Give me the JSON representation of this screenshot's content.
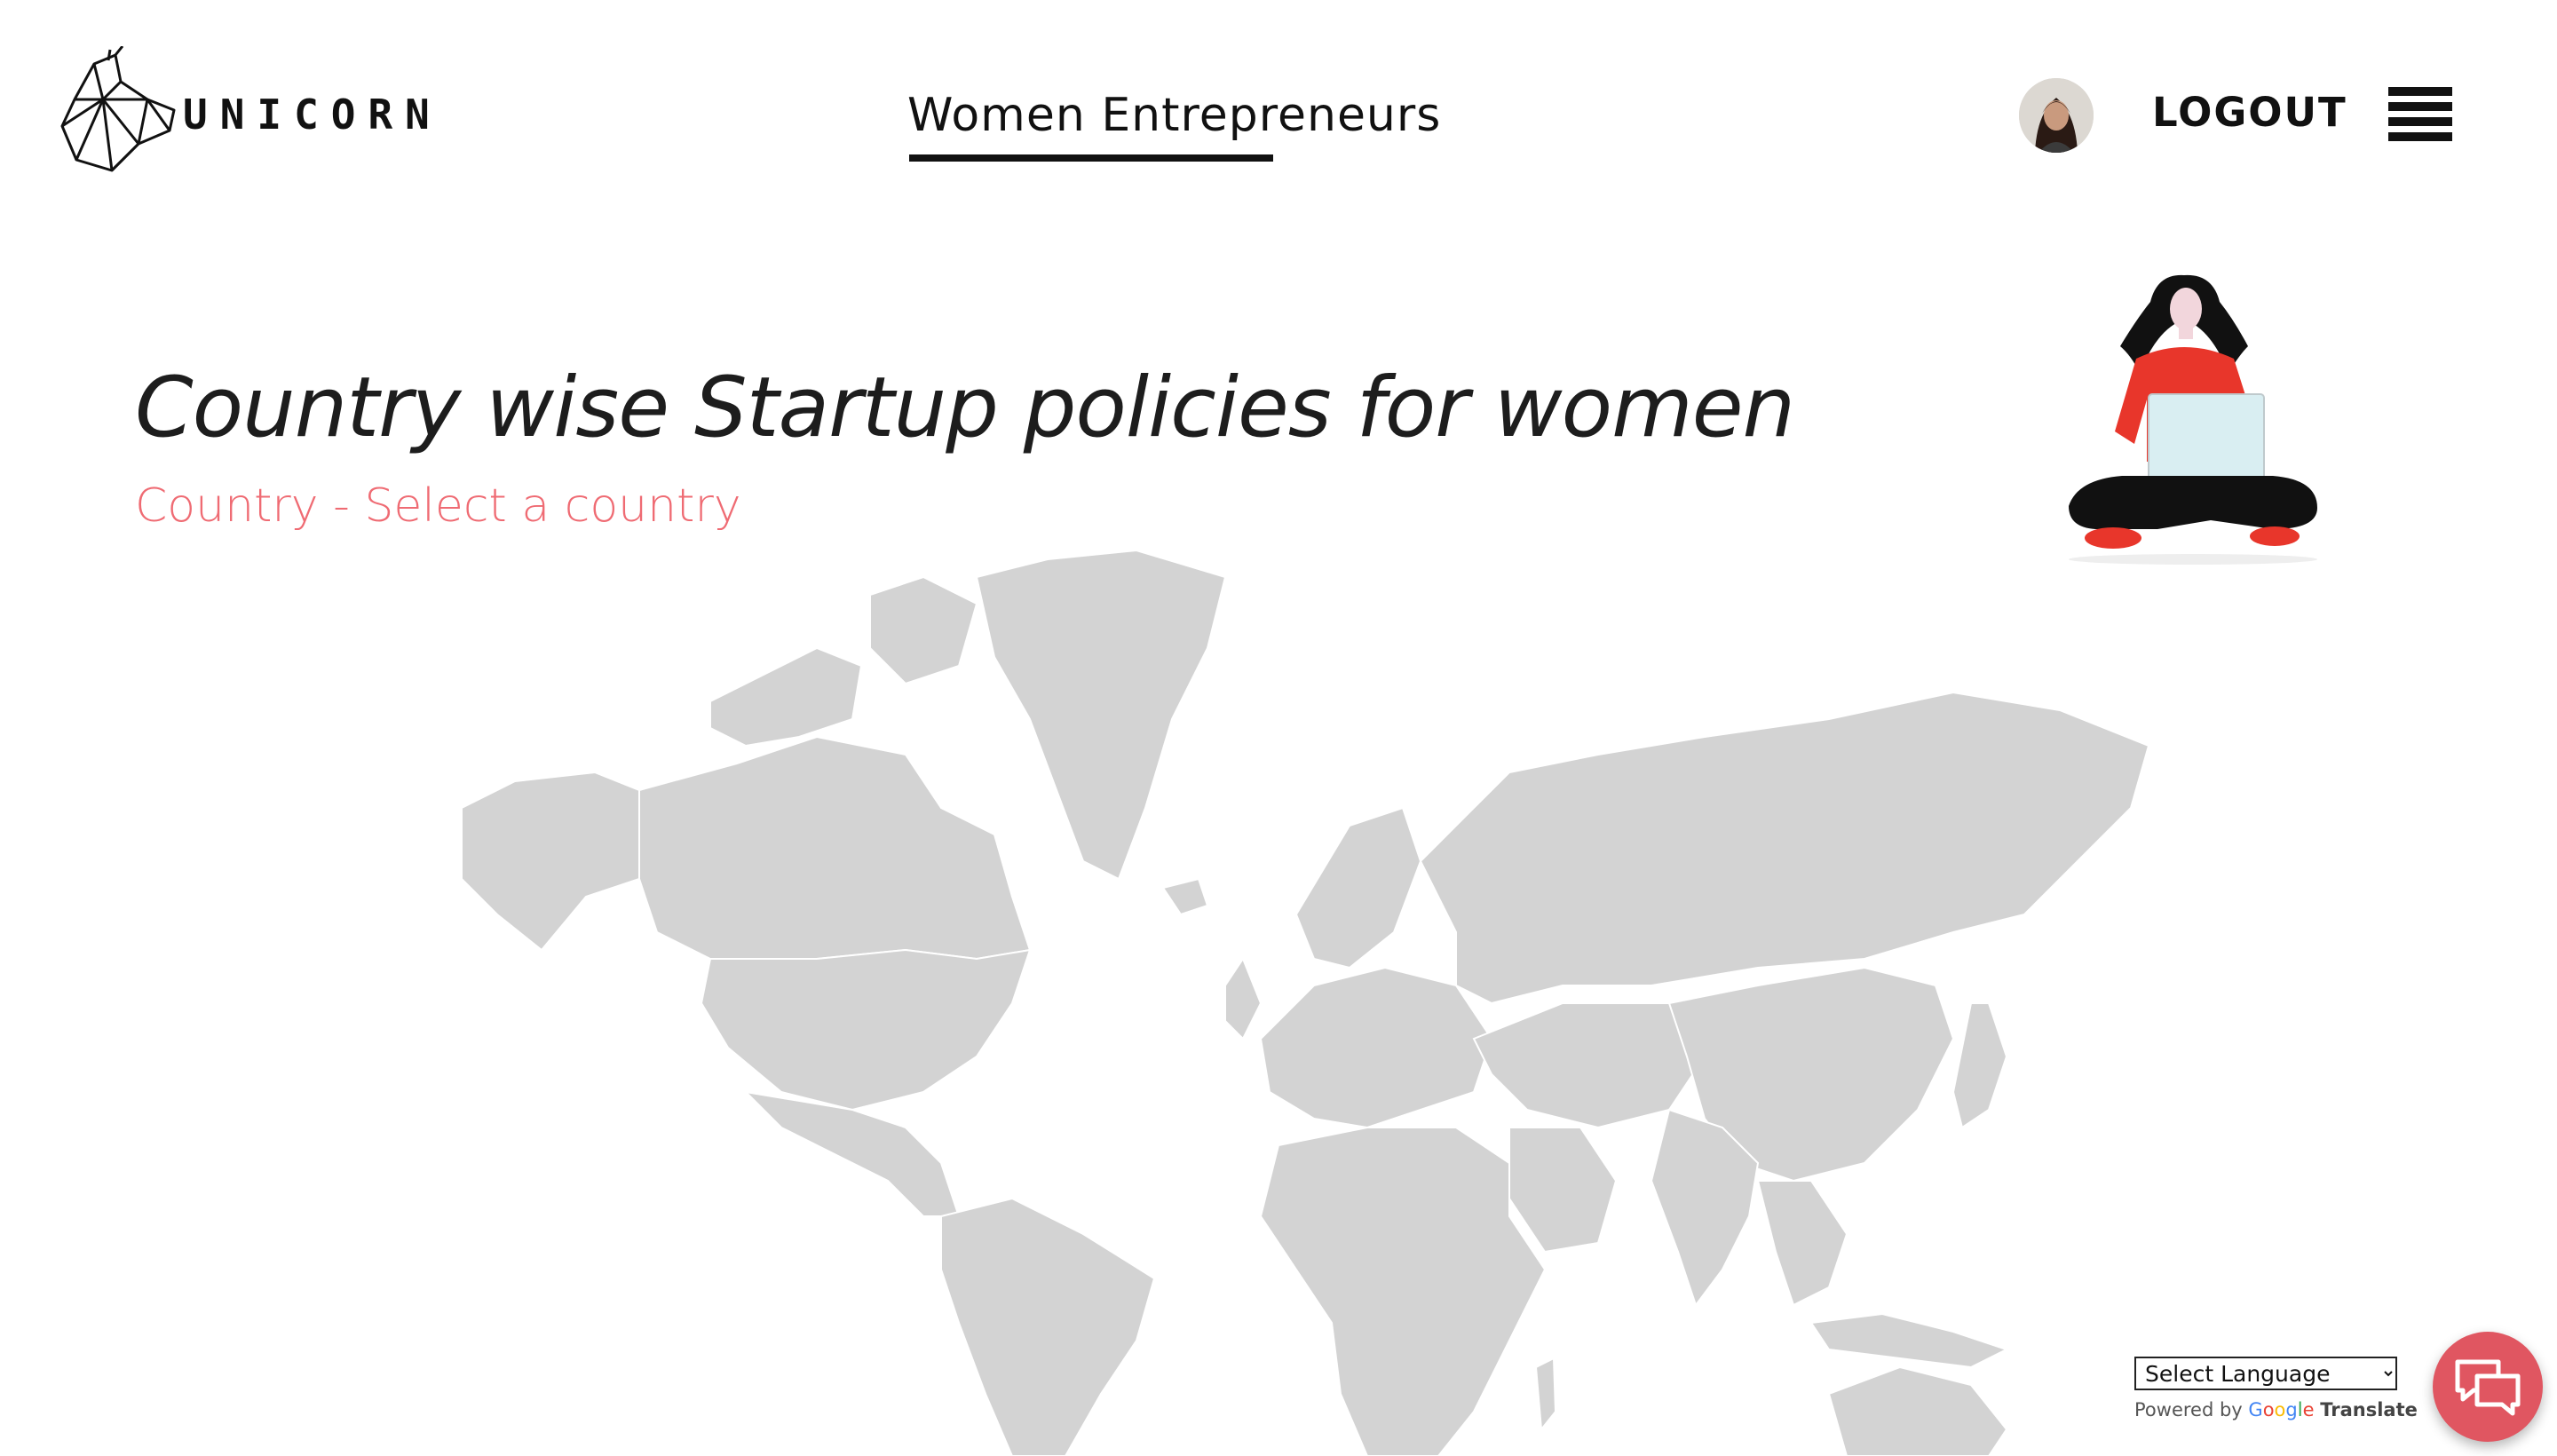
{
  "header": {
    "logo_text": "UNICORN",
    "nav_link": "Women Entrepreneurs",
    "logout_label": "LOGOUT"
  },
  "hero": {
    "title": "Country wise Startup policies for women",
    "subtitle": "Country - Select a country"
  },
  "translate_widget": {
    "select_value": "Select Language",
    "powered_by": "Powered by",
    "google": "Google",
    "translate_word": "Translate"
  },
  "colors": {
    "accent": "#ef6b73",
    "map_land": "#d3d3d3",
    "chat_button": "#e05661",
    "text": "#1d1d1d"
  },
  "icons": {
    "menu": "hamburger-icon",
    "chat": "chat-bubbles-icon"
  }
}
